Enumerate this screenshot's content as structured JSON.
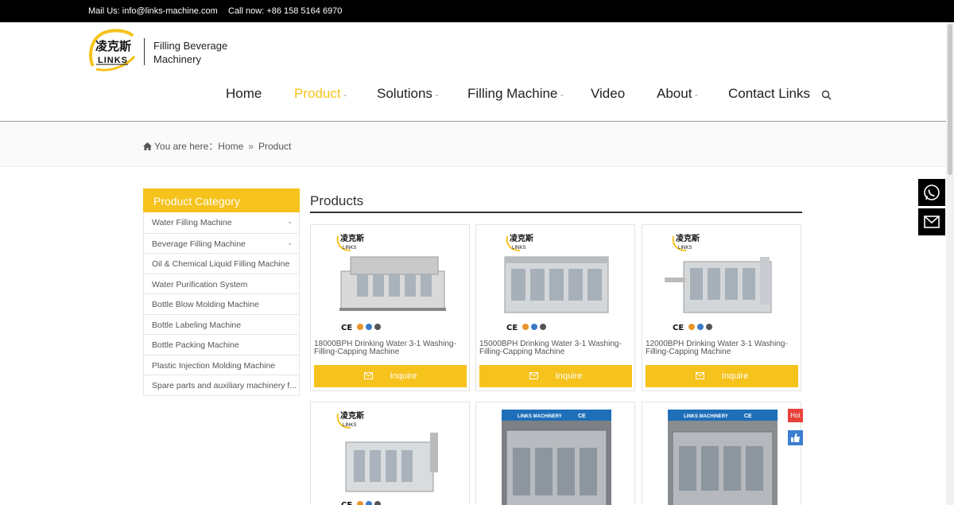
{
  "topbar": {
    "mail": "Mail Us: info@links-machine.com",
    "phone": "Call now: +86 158 5164 6970"
  },
  "brand": {
    "logo_text": "凌克斯",
    "logo_sub": "LINKS",
    "tagline_line1": "Filling Beverage",
    "tagline_line2": "Machinery",
    "accent": "#f6c21c"
  },
  "nav": [
    {
      "label": "Home",
      "has_dropdown": false,
      "active": false
    },
    {
      "label": "Product",
      "has_dropdown": true,
      "active": true
    },
    {
      "label": "Solutions",
      "has_dropdown": true,
      "active": false
    },
    {
      "label": "Filling Machine",
      "has_dropdown": true,
      "active": false
    },
    {
      "label": "Video",
      "has_dropdown": false,
      "active": false
    },
    {
      "label": "About",
      "has_dropdown": true,
      "active": false
    },
    {
      "label": "Contact Links",
      "has_dropdown": false,
      "active": false
    }
  ],
  "breadcrumb": {
    "prefix": "You are here：",
    "home": "Home",
    "separator": "»",
    "current": "Product"
  },
  "sidebar": {
    "title": "Product Category",
    "items": [
      {
        "label": "Water Filling Machine",
        "expandable": true
      },
      {
        "label": "Beverage Filling Machine",
        "expandable": true
      },
      {
        "label": "Oil & Chemical Liquid Filling Machine",
        "expandable": false
      },
      {
        "label": "Water Purification System",
        "expandable": false
      },
      {
        "label": "Bottle Blow Molding Machine",
        "expandable": false
      },
      {
        "label": "Bottle Labeling Machine",
        "expandable": false
      },
      {
        "label": "Bottle Packing Machine",
        "expandable": false
      },
      {
        "label": "Plastic Injection Molding Machine",
        "expandable": false
      },
      {
        "label": "Spare parts and auxiliary machinery f...",
        "expandable": false
      }
    ]
  },
  "products": {
    "title": "Products",
    "inquire_label": "Inquire",
    "items": [
      {
        "name": "18000BPH Drinking Water 3-1 Washing-Filling-Capping Machine"
      },
      {
        "name": "15000BPH Drinking Water 3-1 Washing-Filling-Capping Machine"
      },
      {
        "name": "12000BPH Drinking Water 3-1 Washing-Filling-Capping Machine"
      },
      {
        "name": ""
      },
      {
        "name": ""
      },
      {
        "name": ""
      }
    ],
    "banner_text": "LINKS MACHINERY",
    "hot_label": "Hot"
  }
}
